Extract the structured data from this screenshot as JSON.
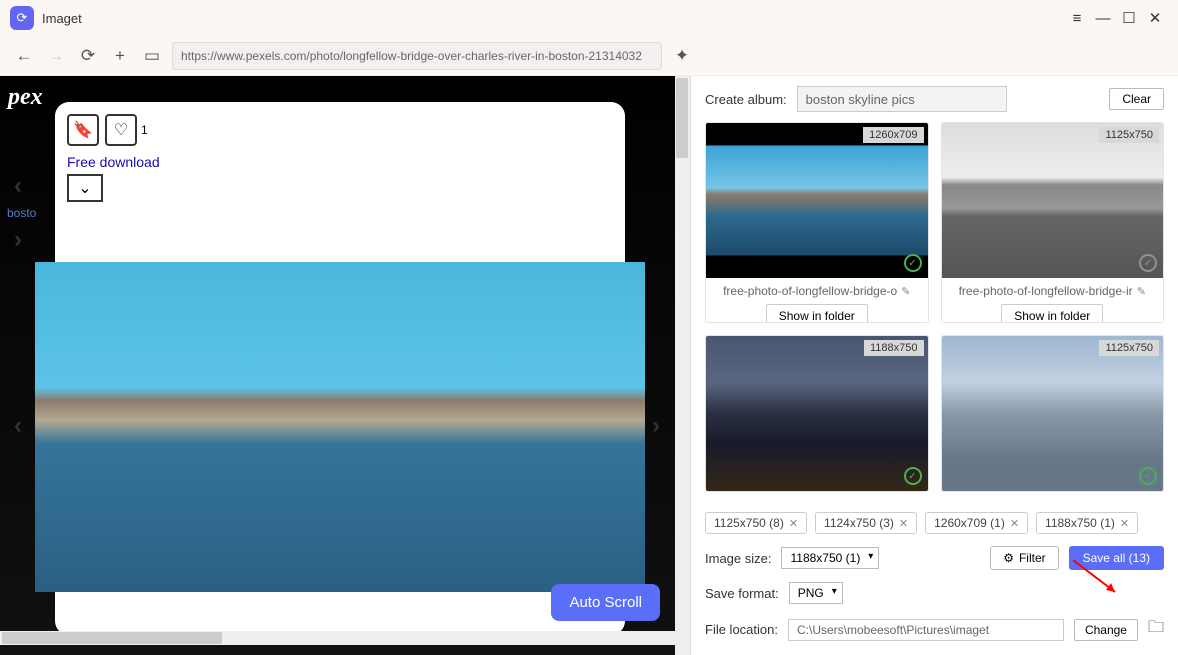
{
  "app": {
    "title": "Imaget"
  },
  "toolbar": {
    "url": "https://www.pexels.com/photo/longfellow-bridge-over-charles-river-in-boston-21314032"
  },
  "browser": {
    "like_count": "1",
    "free_download": "Free download",
    "boston_label": "bosto",
    "auto_scroll": "Auto Scroll"
  },
  "panel": {
    "create_album_label": "Create album:",
    "album_name": "boston skyline pics",
    "clear": "Clear",
    "cards": [
      {
        "size": "1260x709",
        "name": "free-photo-of-longfellow-bridge-o",
        "show": "Show in folder",
        "thumb": "a"
      },
      {
        "size": "1125x750",
        "name": "free-photo-of-longfellow-bridge-ir",
        "show": "Show in folder",
        "thumb": "b"
      },
      {
        "size": "1188x750",
        "name": "",
        "show": "",
        "thumb": "c"
      },
      {
        "size": "1125x750",
        "name": "",
        "show": "",
        "thumb": "d"
      }
    ],
    "chips": [
      "1125x750 (8)",
      "1124x750 (3)",
      "1260x709 (1)",
      "1188x750 (1)"
    ],
    "image_size_label": "Image size:",
    "image_size_value": "1188x750 (1)",
    "filter": "Filter",
    "save_all": "Save all (13)",
    "save_format_label": "Save format:",
    "save_format_value": "PNG",
    "file_location_label": "File location:",
    "file_location_value": "C:\\Users\\mobeesoft\\Pictures\\imaget",
    "change": "Change"
  }
}
